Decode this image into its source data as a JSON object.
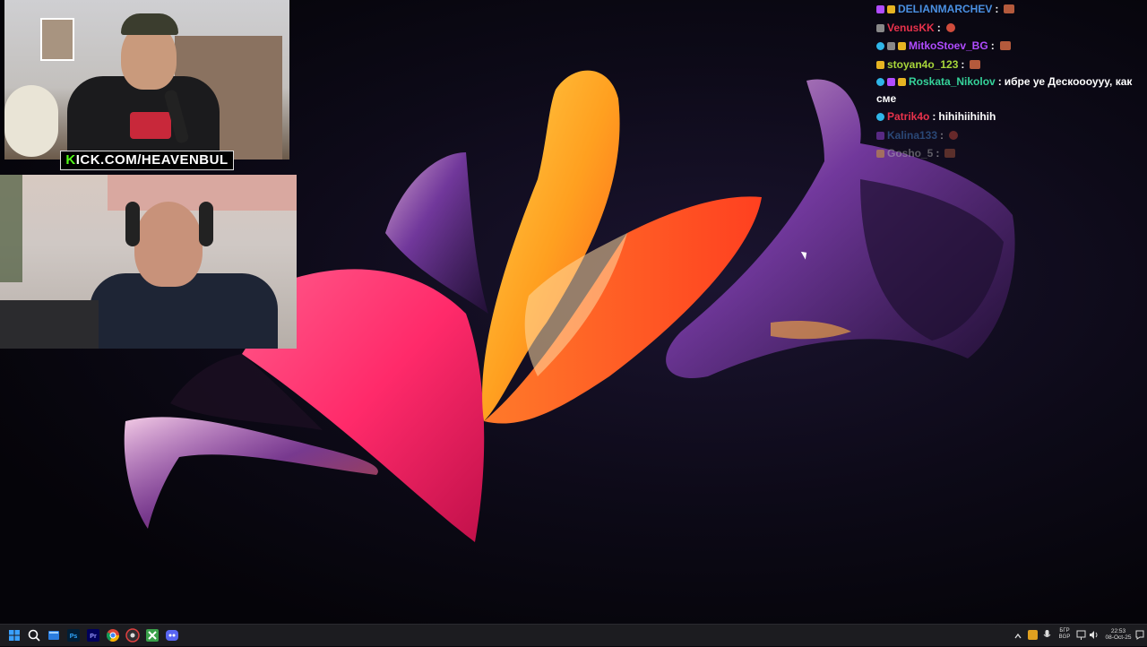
{
  "stream": {
    "overlay_banner": "KICK.COM/HEAVENBUL",
    "banner_prefix": "K",
    "banner_rest": "ICK.COM/HEAVENBUL"
  },
  "chat": {
    "messages": [
      {
        "user": "DELIANMARCHEV",
        "color": "#4a90e2",
        "text": "",
        "badges": [
          "b-pur",
          "b-gold"
        ],
        "emote": "emote"
      },
      {
        "user": "VenusKK",
        "color": "#e8324b",
        "text": "",
        "badges": [
          "b-grey"
        ],
        "emote": "emote round"
      },
      {
        "user": "MitkoStoev_BG",
        "color": "#b04cff",
        "text": "",
        "badges": [
          "b-cyan",
          "b-grey",
          "b-gold"
        ],
        "emote": "emote"
      },
      {
        "user": "stoyan4o_123",
        "color": "#a8d63a",
        "text": "",
        "badges": [
          "b-gold"
        ],
        "emote": "emote"
      },
      {
        "user": "Roskata_Nikolov",
        "color": "#35d39a",
        "text": "ибре уе Дескоооууу, как сме",
        "badges": [
          "b-cyan",
          "b-pur",
          "b-gold"
        ],
        "emote": ""
      },
      {
        "user": "Patrik4o",
        "color": "#e8324b",
        "text": "hihihiihihih",
        "badges": [
          "b-cyan"
        ],
        "emote": ""
      },
      {
        "user": "Kalina133",
        "color": "#4a90e2",
        "text": "",
        "badges": [
          "b-pur"
        ],
        "emote": "emote round"
      },
      {
        "user": "Gosho_5",
        "color": "#bbbbbb",
        "text": "",
        "badges": [
          "b-gold"
        ],
        "emote": "emote"
      }
    ],
    "separator": ":"
  },
  "taskbar": {
    "language_top": "БГР",
    "language_bottom": "BGP",
    "time": "22:53",
    "date": "08-Oct-25",
    "icons": [
      "windows-start-icon",
      "search-icon",
      "task-view-icon",
      "photoshop-icon",
      "premiere-icon",
      "chrome-icon",
      "obs-icon",
      "game-icon",
      "discord-icon"
    ]
  },
  "colors": {
    "taskbar_bg": "#1c1c20",
    "kick_green": "#53fc18"
  }
}
